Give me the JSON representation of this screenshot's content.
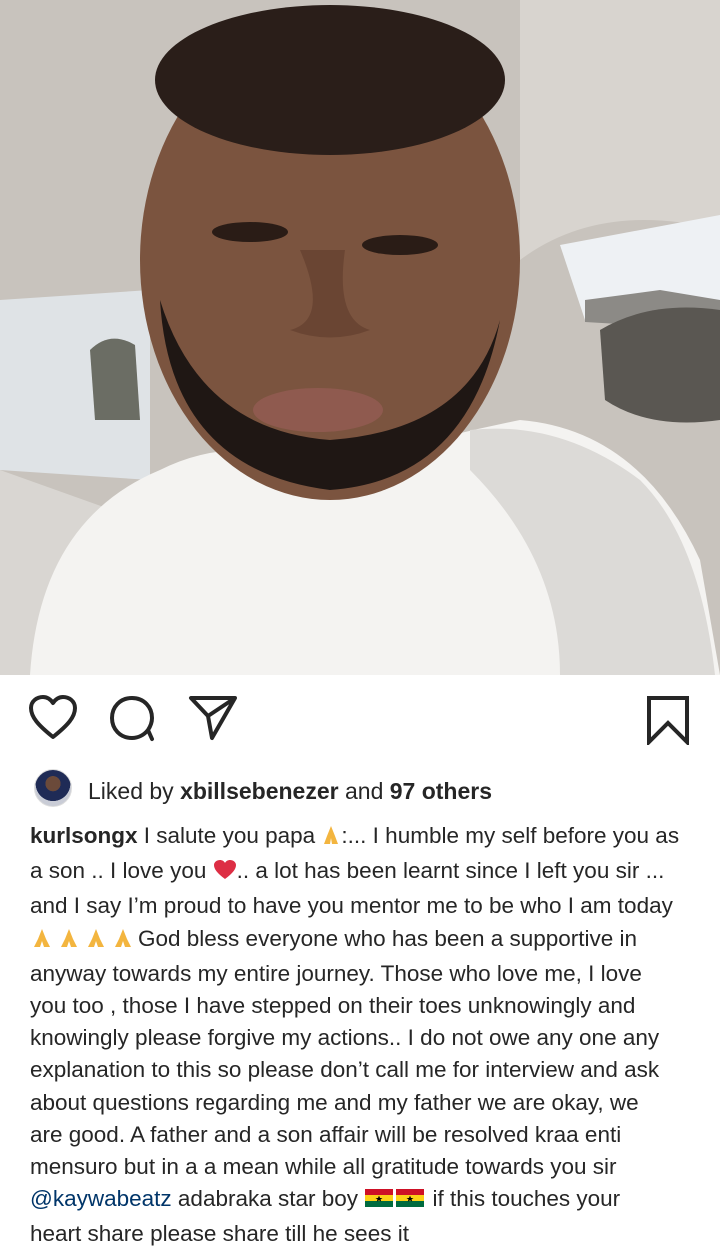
{
  "post": {
    "photo_alt": "selfie in car",
    "actions": {
      "like_icon": "heart-outline-icon",
      "comment_icon": "speech-bubble-icon",
      "share_icon": "paper-plane-icon",
      "save_icon": "bookmark-icon"
    },
    "likes": {
      "prefix": "Liked by ",
      "user": "xbillsebenezer",
      "middle": " and ",
      "others": "97 others"
    },
    "caption": {
      "username": "kurlsongx",
      "mention": "@kaywabeatz",
      "lines": [
        " I salute you papa ",
        ":... I humble my self before you as",
        "a son .. I love you ",
        ".. a lot has been learnt since I left you sir ...",
        "and I say I’m proud to have you mentor me to be who I am today",
        "God bless everyone who has been a supportive in",
        "anyway towards my entire journey. Those who love me, I love",
        "you too , those I have stepped on their toes unknowingly and",
        "knowingly please forgive my actions.. I do not owe any one any",
        "explanation to this so please don’t call me for interview and ask",
        "about questions regarding me and my father we are okay, we",
        "are good. A father and a son affair will be resolved kraa enti",
        "mensuro but in a a mean while all gratitude  towards you sir",
        "  adabraka star boy ",
        " if this touches your",
        "heart share please share till he sees it"
      ]
    }
  }
}
